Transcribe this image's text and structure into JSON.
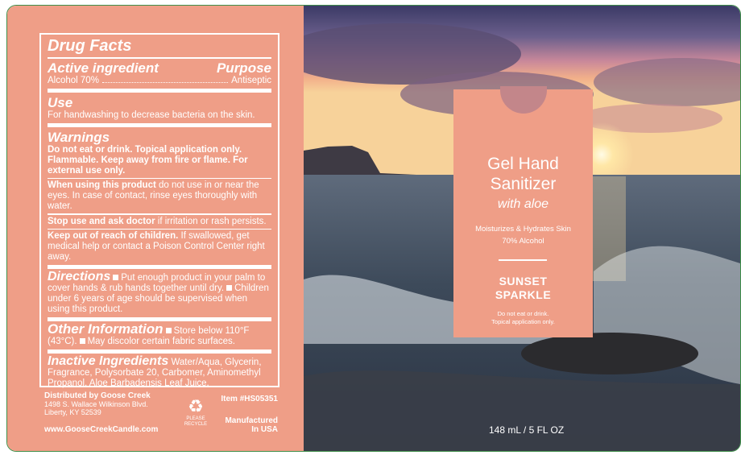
{
  "drug_facts": {
    "title": "Drug Facts",
    "active_heading": "Active ingredient",
    "purpose_heading": "Purpose",
    "active_name": "Alcohol 70%",
    "active_purpose": "Antiseptic",
    "use_heading": "Use",
    "use_text": "For handwashing to decrease bacteria on the skin.",
    "warnings_heading": "Warnings",
    "warnings_bold": "Do not eat or drink. Topical application only. Flammable. Keep away from fire or flame. For external use only.",
    "when_using_bold": "When using this product",
    "when_using_text": "do not use in or near the eyes. In case of contact, rinse eyes thoroughly with water.",
    "stop_use_bold": "Stop use and ask doctor",
    "stop_use_text": "if irritation or rash persists.",
    "keep_out_bold": "Keep out of reach of children.",
    "keep_out_text": "If swallowed, get medical help or contact a Poison Control Center right away.",
    "directions_heading": "Directions",
    "directions_1": "Put enough product in your palm to cover hands & rub hands together until dry.",
    "directions_2": "Children under 6 years of age should be supervised when using this product.",
    "other_heading": "Other Information",
    "other_1": "Store below 110°F (43°C).",
    "other_2": "May discolor certain fabric surfaces.",
    "inactive_heading": "Inactive Ingredients",
    "inactive_text": "Water/Aqua, Glycerin, Fragrance, Polysorbate 20, Carbomer, Aminomethyl Propanol, Aloe Barbadensis Leaf Juice."
  },
  "footer": {
    "distributor": "Distributed by Goose Creek",
    "address_1": "1498 S. Wallace Wilkinson Blvd.",
    "address_2": "Liberty, KY 52539",
    "website": "www.GooseCreekCandle.com",
    "recycle_1": "PLEASE",
    "recycle_2": "RECYCLE",
    "item": "Item #HS05351",
    "manufactured_1": "Manufactured",
    "manufactured_2": "In USA"
  },
  "front": {
    "title_1": "Gel Hand",
    "title_2": "Sanitizer",
    "subtitle": "with aloe",
    "claim": "Moisturizes & Hydrates Skin",
    "alcohol": "70% Alcohol",
    "scent_1": "SUNSET",
    "scent_2": "SPARKLE",
    "warn_1": "Do not eat or drink.",
    "warn_2": "Topical application only.",
    "size": "148 mL / 5 FL OZ"
  },
  "colors": {
    "label_pink": "#ef9e87",
    "border_green": "#3f8f4a",
    "text_white": "#ffffff"
  },
  "icons": [
    "recycle-icon"
  ]
}
